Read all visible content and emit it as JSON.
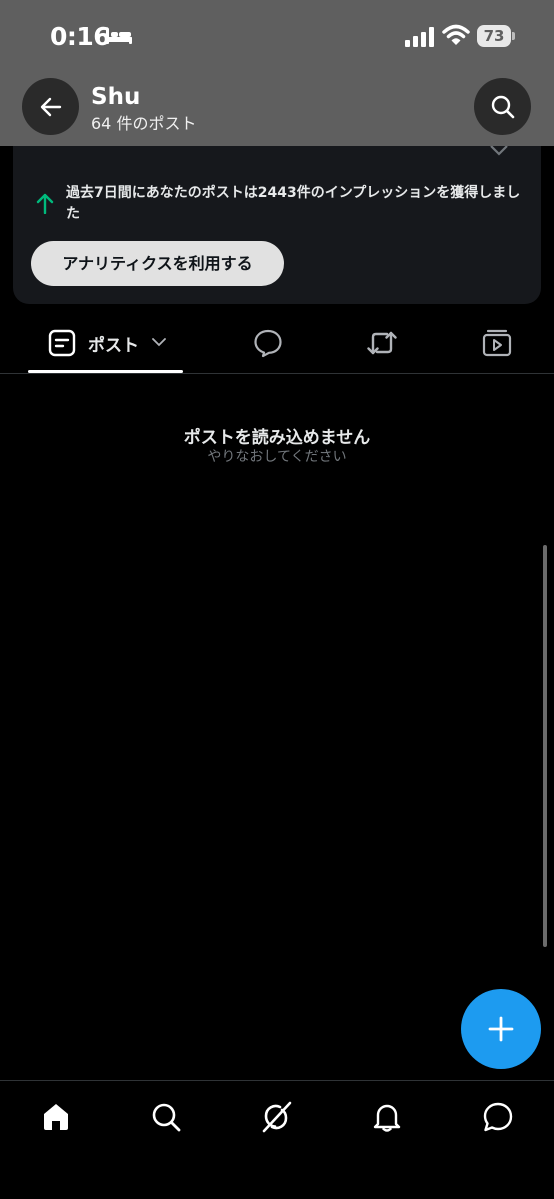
{
  "status_bar": {
    "time": "0:16",
    "battery": "73"
  },
  "header": {
    "name": "Shu",
    "post_count": "64 件のポスト"
  },
  "analytics": {
    "impressions_text": "過去7日間にあなたのポストは2443件のインプレッションを獲得しました",
    "button_label": "アナリティクスを利用する"
  },
  "tabs": {
    "posts_label": "ポスト"
  },
  "empty_state": {
    "title": "ポストを読み込めません",
    "subtitle": "やりなおしてください"
  },
  "colors": {
    "accent": "#1d9bf0",
    "up_arrow": "#00ba7c",
    "header_bg": "#5f5f5f"
  },
  "icons": [
    "bed-icon",
    "signal-icon",
    "wifi-icon",
    "back-arrow-icon",
    "search-icon",
    "close-icon",
    "up-arrow-icon",
    "posts-icon",
    "chevron-down-icon",
    "reply-icon",
    "repost-icon",
    "media-icon",
    "plus-icon",
    "home-icon",
    "grok-icon",
    "bell-icon",
    "messages-icon"
  ]
}
